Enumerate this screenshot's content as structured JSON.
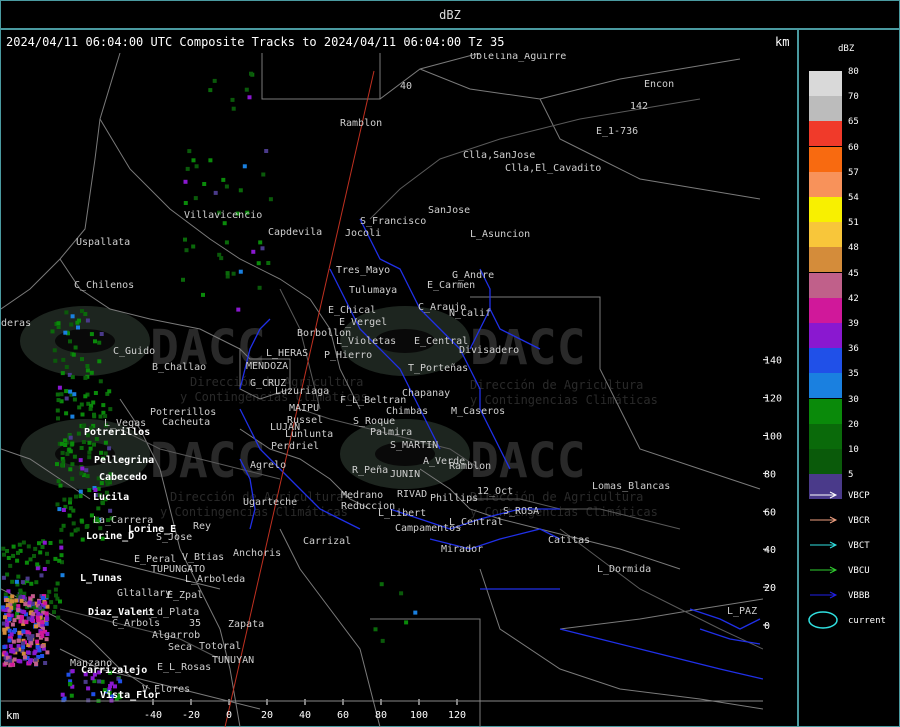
{
  "window": {
    "title": "dBZ"
  },
  "header": {
    "text": "2024/04/11 06:04:00 UTC Composite Tracks to 2024/04/11 06:04:00 Tz 35",
    "km_top": "km",
    "km_bottom": "km"
  },
  "legend": {
    "title": "dBZ",
    "scale": [
      {
        "label": "80",
        "color": "#d9d9d9"
      },
      {
        "label": "70",
        "color": "#bcbcbc"
      },
      {
        "label": "65",
        "color": "#f03a2a"
      },
      {
        "label": "60",
        "color": "#f86a10"
      },
      {
        "label": "57",
        "color": "#f8925a"
      },
      {
        "label": "54",
        "color": "#f8f000"
      },
      {
        "label": "51",
        "color": "#f8c63a"
      },
      {
        "label": "48",
        "color": "#d48c3a"
      },
      {
        "label": "45",
        "color": "#c0608a"
      },
      {
        "label": "42",
        "color": "#d0189a"
      },
      {
        "label": "39",
        "color": "#8a18d0"
      },
      {
        "label": "36",
        "color": "#2050e8"
      },
      {
        "label": "35",
        "color": "#1a80e0"
      },
      {
        "label": "30",
        "color": "#0a8a0a"
      },
      {
        "label": "20",
        "color": "#0a6a0a"
      },
      {
        "label": "10",
        "color": "#0a5a0a"
      },
      {
        "label": "5",
        "color": "#4a3a8a"
      }
    ],
    "tracks": [
      {
        "label": "VBCP",
        "color": "#ffffff"
      },
      {
        "label": "VBCR",
        "color": "#f0a080"
      },
      {
        "label": "VBCT",
        "color": "#30e0e0"
      },
      {
        "label": "VBCU",
        "color": "#30d030"
      },
      {
        "label": "VBBB",
        "color": "#2020e8"
      }
    ],
    "current_label": "current",
    "current_color": "#30e0e0"
  },
  "axes": {
    "y_ticks": [
      "140",
      "120",
      "100",
      "80",
      "60",
      "40",
      "20",
      "0"
    ],
    "x_ticks": [
      "-40",
      "-20",
      "0",
      "20",
      "40",
      "60",
      "80",
      "100",
      "120"
    ]
  },
  "watermark": {
    "logo": "DACC",
    "subtitle1": "Dirección de Agricultura",
    "subtitle2": "y Contingencias Climáticas"
  },
  "places": {
    "Encon": "Encon",
    "E_1_736": "E_1-736",
    "Ramblon1": "Ramblon",
    "Clla_SanJose": "Clla,SanJose",
    "Clla_ElCavadito": "Clla,El_Cavadito",
    "SanJose": "SanJose",
    "L_Asuncion": "L_Asuncion",
    "S_Francisco": "S_Francisco",
    "Jocoli": "Jocoli",
    "Capdevila": "Capdevila",
    "Villavicencio": "Villavicencio",
    "Uspallata": "Uspallata",
    "C_Chilenos": "C_Chilenos",
    "Tres_Mayo": "Tres_Mayo",
    "Tulumaya": "Tulumaya",
    "G_Andre": "G_Andre",
    "E_Carmen": "E_Carmen",
    "E_Chical": "E_Chical",
    "E_Vergel": "E_Vergel",
    "C_Araujo": "C_Araujo",
    "N_Calif": "N_Calif",
    "Borbollon": "Borbollon",
    "L_Violetas": "L_Violetas",
    "E_Central": "E_Central",
    "Divisadero": "Divisadero",
    "deras": "deras",
    "C_Guido": "C_Guido",
    "L_HERAS": "L_HERAS",
    "P_Hierro": "P_Hierro",
    "T_Portenas": "T_Porteñas",
    "MENDOZA": "MENDOZA",
    "B_Challao": "B_Challao",
    "G_CRUZ": "G_CRUZ",
    "Luzuriaga": "Luzuriaga",
    "Chapanay": "Chapanay",
    "F_L_Beltran": "F_L_Beltran",
    "MAIPU": "MAIPU",
    "Chimbas": "Chimbas",
    "M_Caseros": "M_Caseros",
    "L_Vegas": "L_Vegas",
    "Potrerillos1": "Potrerillos",
    "Cacheuta": "Cacheuta",
    "Russel": "Russel",
    "S_Roque": "S_Roque",
    "Palmira": "Palmira",
    "Potrerillos2": "Potrerillos",
    "LUJAN": "LUJAN",
    "Lunlunta": "Lunlunta",
    "S_MARTIN": "S_MARTIN",
    "Perdriel": "Perdriel",
    "A_Verde": "A_Verde",
    "Pellegrina": "Pellegrina",
    "Agrelo": "Agrelo",
    "R_Pena": "R_Peña",
    "JUNIN": "JUNIN",
    "Ramblon2": "Ramblon",
    "Cabecedo": "Cabecedo",
    "Lomas_Blancas": "Lomas_Blancas",
    "Lucila": "Lucila",
    "Medrano": "Medrano",
    "RIVAD": "RIVAD",
    "Phillips": "Phillips",
    "Oct12": "12_Oct",
    "Ugarteche": "Ugarteche",
    "Reduccion": "Reduccion",
    "L_Libert": "L_Libert",
    "S_ROSA": "S_ROSA",
    "La_Carrera": "La_Carrera",
    "Rey": "Rey",
    "L_Central": "L_Central",
    "Lorine_E": "Lorine_E",
    "Campamentos": "Campamentos",
    "Lorine_D": "Lorine_D",
    "S_Jose": "S_Jose",
    "Carrizal": "Carrizal",
    "Catitas": "Catitas",
    "E_Peral": "E_Peral",
    "V_Btias": "V_Btias",
    "Anchoris": "Anchoris",
    "Mirador": "Mirador",
    "TUPUNGATO": "TUPUNGATO",
    "L_Dormida": "L_Dormida",
    "L_Tunas": "L_Tunas",
    "L_Arboleda": "L_Arboleda",
    "Gltallary": "Gltallary",
    "E_Zpal": "E_Zpal",
    "Diaz_Valent": "Diaz_Valent",
    "L_d_Plata": "L_d_Plata",
    "L_PAZ": "L_PAZ",
    "C_Arbols": "C_Arbols",
    "n35": "35",
    "Zapata": "Zapata",
    "Algarrob": "Algarrob",
    "Seca": "Seca",
    "Totoral": "Totoral",
    "Manzano": "Manzano",
    "E_L_Rosas": "E_L_Rosas",
    "TUNUYAN": "TUNUYAN",
    "Carrizalejo": "Carrizalejo",
    "V_Flores": "V_Flores",
    "Vista_Flor": "Vista_Flor",
    "r40": "40",
    "r142": "142",
    "Oblelina": "Oblelina_Aguirre"
  }
}
